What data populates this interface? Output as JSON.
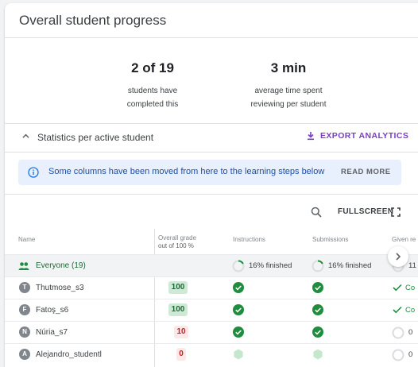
{
  "title": "Overall student progress",
  "stats": [
    {
      "value": "2 of 19",
      "line1": "students have",
      "line2": "completed this"
    },
    {
      "value": "3 min",
      "line1": "average time spent",
      "line2": "reviewing per student"
    }
  ],
  "section": {
    "label": "Statistics per active student",
    "export_label": "EXPORT ANALYTICS"
  },
  "banner": {
    "message": "Some columns have been moved from here to the learning steps below",
    "read_more": "READ MORE"
  },
  "toolbar": {
    "fullscreen_label": "FULLSCREEN"
  },
  "columns": {
    "name": "Name",
    "grade_line1": "Overall grade",
    "grade_line2": "out of 100 %",
    "instructions": "Instructions",
    "submissions": "Submissions",
    "given": "Given re"
  },
  "everyone": {
    "label": "Everyone (19)",
    "instructions_pct": "16% finished",
    "submissions_pct": "16% finished",
    "given_pct": "11"
  },
  "students": [
    {
      "initial": "T",
      "name": "Thutmose_s3",
      "grade": "100",
      "given": "Co"
    },
    {
      "initial": "F",
      "name": "Fatoş_s6",
      "grade": "100",
      "given": "Co"
    },
    {
      "initial": "N",
      "name": "Núria_s7",
      "grade": "10",
      "given": "0"
    },
    {
      "initial": "A",
      "name": "Alejandro_studentl",
      "grade": "0",
      "given": "0"
    }
  ],
  "colors": {
    "accent": "#7a3fc0",
    "green": "#1e8e3e",
    "info": "#1a73e8"
  }
}
